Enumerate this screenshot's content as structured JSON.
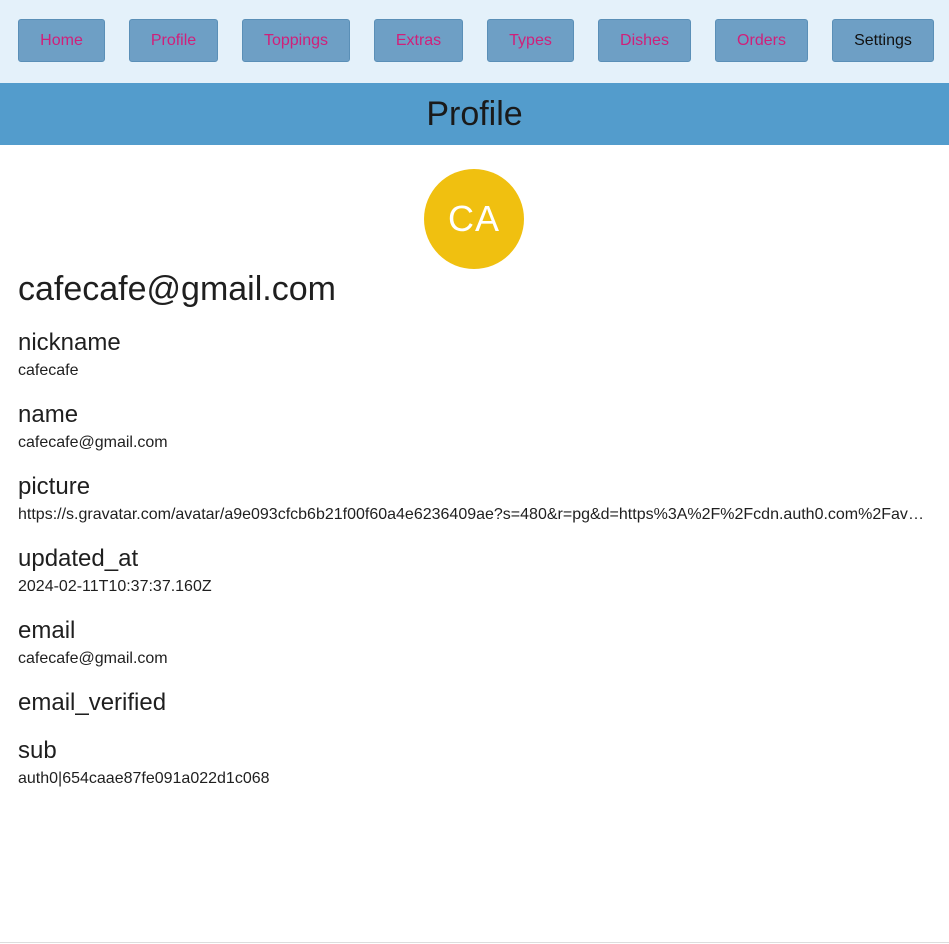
{
  "nav": {
    "items": [
      {
        "label": "Home"
      },
      {
        "label": "Profile"
      },
      {
        "label": "Toppings"
      },
      {
        "label": "Extras"
      },
      {
        "label": "Types"
      },
      {
        "label": "Dishes"
      },
      {
        "label": "Orders"
      },
      {
        "label": "Settings"
      }
    ],
    "link_color": "#d0207a",
    "button_color": "#6e9fc5"
  },
  "page": {
    "title": "Profile",
    "title_bar_color": "#539ccc"
  },
  "profile": {
    "avatar_initials": "CA",
    "avatar_color": "#f0c010",
    "heading": "cafecafe@gmail.com",
    "fields": [
      {
        "label": "nickname",
        "value": "cafecafe"
      },
      {
        "label": "name",
        "value": "cafecafe@gmail.com"
      },
      {
        "label": "picture",
        "value": "https://s.gravatar.com/avatar/a9e093cfcb6b21f00f60a4e6236409ae?s=480&r=pg&d=https%3A%2F%2Fcdn.auth0.com%2Favatars%2Fca.png"
      },
      {
        "label": "updated_at",
        "value": "2024-02-11T10:37:37.160Z"
      },
      {
        "label": "email",
        "value": "cafecafe@gmail.com"
      },
      {
        "label": "email_verified",
        "value": ""
      },
      {
        "label": "sub",
        "value": "auth0|654caae87fe091a022d1c068"
      }
    ]
  }
}
